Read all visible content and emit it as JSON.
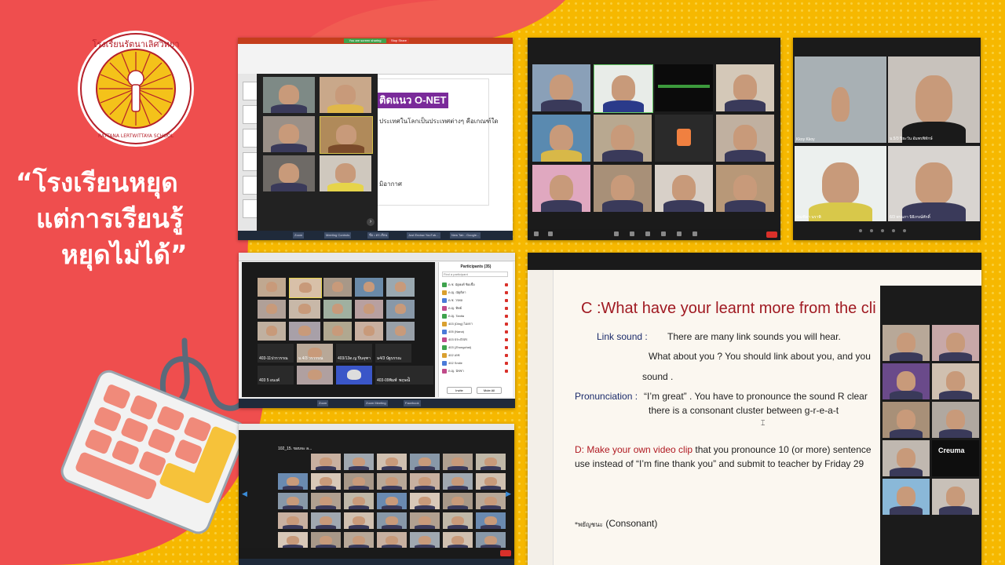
{
  "slogan": {
    "line1": "“โรงเรียนหยุด",
    "line2": "แต่การเรียนรู้",
    "line3": "หยุดไม่ได้”"
  },
  "logo": {
    "top_text": "โรงเรียนรัตนาเลิศวิทยา",
    "school_en": "RATTANA LERTWITTAYA SCHOOL"
  },
  "ppt_window": {
    "title": "You are screen sharing",
    "stop_label": "Stop Share",
    "onet_label": "ติดแนว O-NET",
    "body_text": "ประเทศในโลกเป็นประเทศต่างๆ คือเกณฑ์ใด",
    "body_text2": "มิอากาศ"
  },
  "zoom_participants": {
    "title": "Participants (35)",
    "search_placeholder": "Find a participant",
    "names": [
      "ด.ช. นัฐพงศ์ ชิดเชื้อ",
      "ด.ญ. ณัฐธิดา",
      "ด.ช. วรพล",
      "ด.ญ. ทิพย์",
      "ด.ญ. Tanita",
      "403 (Ding) ไอยรา",
      "405 (Nana)",
      "403 ประภัสสร",
      "403 (Zhongchai)",
      "402 เดช",
      "402 Smile",
      "ด.ญ. นัชชา"
    ],
    "grid_names": [
      "403-11ปวรวรรณ",
      "ม.4/3 วรวรรณ",
      "403/13ด.ญ ปิ่นจุฑา",
      "ม4/3 นัฐบรรณ",
      "403 5 อนงค์",
      "403-09พิมพ์นารา",
      "พฤษณ์ิ"
    ],
    "invite_label": "Invite",
    "mute_all_label": "Mute All"
  },
  "zoom_grid_bottom": {
    "title": "102_15. ขอบจะ ล..."
  },
  "zoom_top_right": {
    "names": [
      "Kkoy Kkoy",
      "ม.5/3 ปิยะวัน อัมพรพิทักษ์",
      "บัณฑิตา นราพิ",
      "6/3 พรนภา นิธิภรณ์ศักดิ์"
    ]
  },
  "slide": {
    "question": "C :What have your learnt more from the cli",
    "link_label": "Link sound :",
    "link_text": "There are many link sounds you will hear.",
    "link_text2": "What about you ? You should link about you, and you",
    "link_text3": "sound .",
    "pron_label": "Pronunciation :",
    "pron_text": "“I’m great” . You have to pronounce the sound  R clear",
    "pron_text2": "there is a consonant cluster between g-r-e-a-t",
    "task_a": "D: Make your own video clip",
    "task_b": " that you pronounce 10 (or more) sentence",
    "task_c": "use instead of “I’m fine thank you” and submit to teacher by  Friday 29",
    "note": "(Consonant)",
    "note_prefix": "*พยัญชนะ",
    "side_name": "Creuma"
  },
  "taskbars": {
    "ppt_items": [
      "Zoom",
      "Meeting Controls",
      "ชื่อ • ดร.เรียน",
      "Just Endow YouTub...",
      "New Tab - Google..."
    ],
    "participants_items": [
      "Zoom",
      "Zoom Meeting",
      "Facebook"
    ]
  },
  "colors": {
    "bg_yellow": "#f6b800",
    "blob_red": "#ef4e4e",
    "slide_red": "#a01a22",
    "slide_blue": "#1a2a6a",
    "logo_red": "#b5202a"
  }
}
